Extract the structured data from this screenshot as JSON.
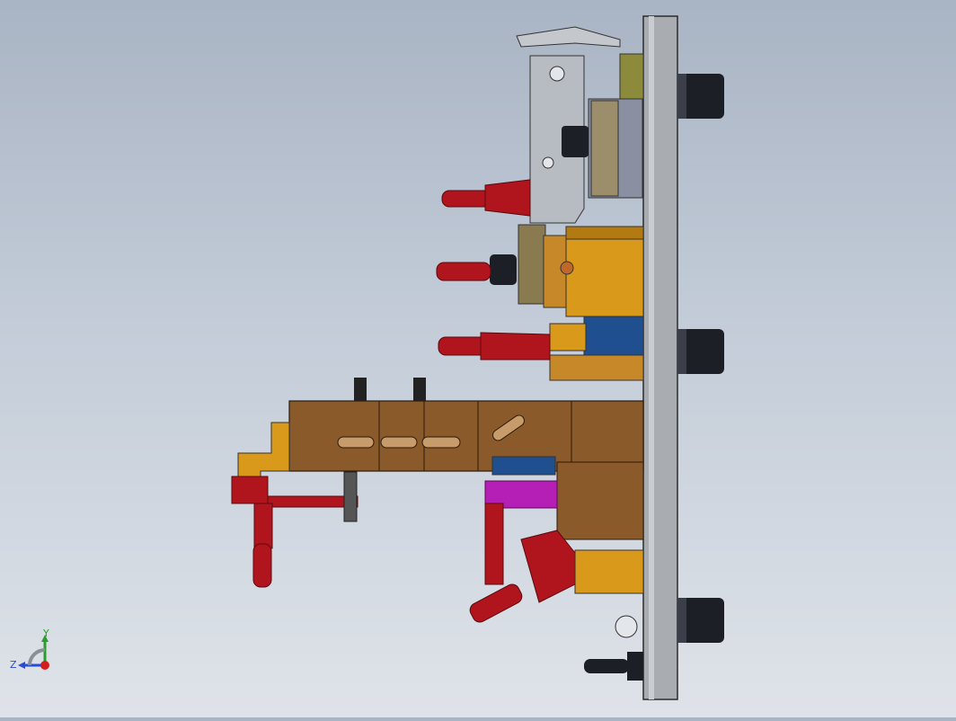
{
  "viewport": {
    "view": "cad-model-side-view",
    "colors": {
      "background_top": "#a9b4c4",
      "background_bottom": "#dfe3e9",
      "plate": "#a9acb0",
      "bronze": "#8a5a2b",
      "orange": "#d99a1c",
      "red": "#b0151e",
      "blue": "#1f4f8f",
      "magenta": "#b51fb5",
      "black": "#1c1f26",
      "gray_part": "#b7bcc2"
    }
  },
  "triad": {
    "y_label": "Y",
    "z_label": "Z",
    "y_color": "#2a9d2a",
    "z_color": "#2a4bd6",
    "origin_color": "#d11f1f"
  }
}
